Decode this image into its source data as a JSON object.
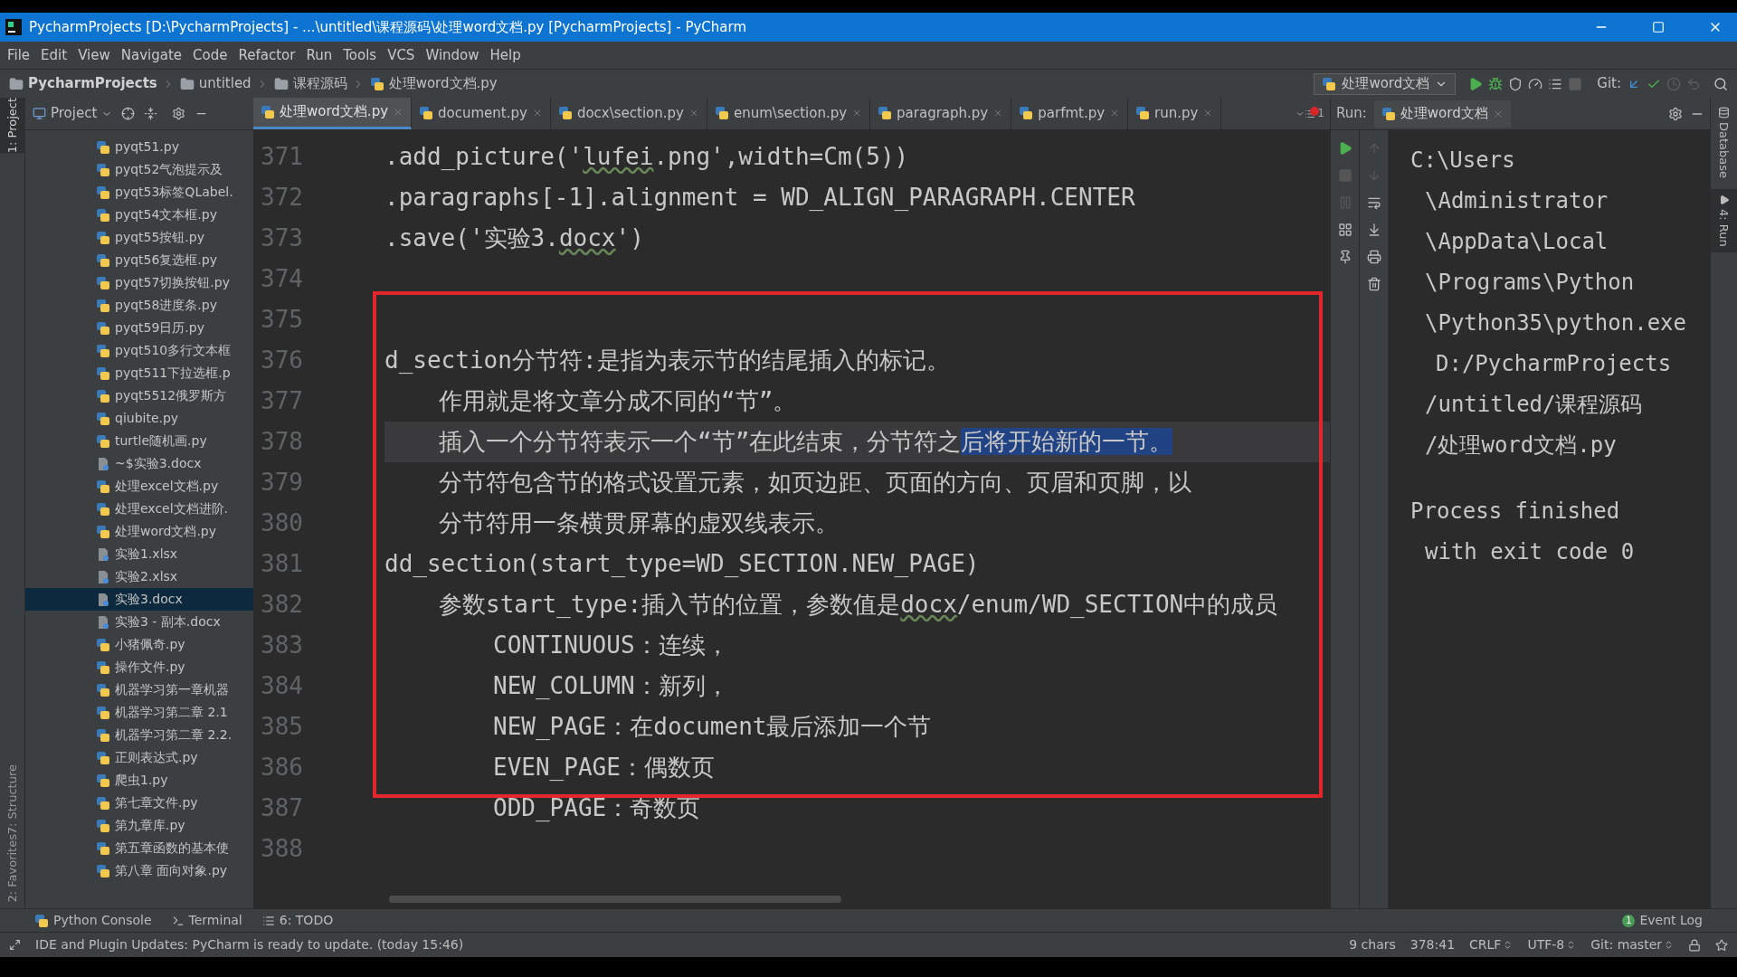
{
  "window": {
    "title": "PycharmProjects [D:\\PycharmProjects] - ...\\untitled\\课程源码\\处理word文档.py [PycharmProjects] - PyCharm"
  },
  "menu": [
    "File",
    "Edit",
    "View",
    "Navigate",
    "Code",
    "Refactor",
    "Run",
    "Tools",
    "VCS",
    "Window",
    "Help"
  ],
  "breadcrumbs": [
    {
      "label": "PycharmProjects",
      "kind": "root"
    },
    {
      "label": "untitled",
      "kind": "folder"
    },
    {
      "label": "课程源码",
      "kind": "folder"
    },
    {
      "label": "处理word文档.py",
      "kind": "py"
    }
  ],
  "run_config": "处理word文档",
  "git_label": "Git:",
  "left_side_tabs": [
    {
      "label": "1: Project",
      "selected": true
    },
    {
      "label": "7: Structure",
      "selected": false
    },
    {
      "label": "2: Favorites",
      "selected": false
    }
  ],
  "project": {
    "title": "Project",
    "items": [
      {
        "label": "pyqt51.py",
        "kind": "py",
        "selected": false
      },
      {
        "label": "pyqt52气泡提示及",
        "kind": "py",
        "selected": false
      },
      {
        "label": "pyqt53标签QLabel.",
        "kind": "py",
        "selected": false
      },
      {
        "label": "pyqt54文本框.py",
        "kind": "py",
        "selected": false
      },
      {
        "label": "pyqt55按钮.py",
        "kind": "py",
        "selected": false
      },
      {
        "label": "pyqt56复选框.py",
        "kind": "py",
        "selected": false
      },
      {
        "label": "pyqt57切换按钮.py",
        "kind": "py",
        "selected": false
      },
      {
        "label": "pyqt58进度条.py",
        "kind": "py",
        "selected": false
      },
      {
        "label": "pyqt59日历.py",
        "kind": "py",
        "selected": false
      },
      {
        "label": "pyqt510多行文本框",
        "kind": "py",
        "selected": false
      },
      {
        "label": "pyqt511下拉选框.p",
        "kind": "py",
        "selected": false
      },
      {
        "label": "pyqt5512俄罗斯方",
        "kind": "py",
        "selected": false
      },
      {
        "label": "qiubite.py",
        "kind": "py",
        "selected": false
      },
      {
        "label": "turtle随机画.py",
        "kind": "py",
        "selected": false
      },
      {
        "label": "~$实验3.docx",
        "kind": "file",
        "selected": false
      },
      {
        "label": "处理excel文档.py",
        "kind": "py",
        "selected": false
      },
      {
        "label": "处理excel文档进阶.",
        "kind": "py",
        "selected": false
      },
      {
        "label": "处理word文档.py",
        "kind": "py",
        "selected": false
      },
      {
        "label": "实验1.xlsx",
        "kind": "file",
        "selected": false
      },
      {
        "label": "实验2.xlsx",
        "kind": "file",
        "selected": false
      },
      {
        "label": "实验3.docx",
        "kind": "file",
        "selected": true
      },
      {
        "label": "实验3 - 副本.docx",
        "kind": "file",
        "selected": false
      },
      {
        "label": "小猪佩奇.py",
        "kind": "py",
        "selected": false
      },
      {
        "label": "操作文件.py",
        "kind": "py",
        "selected": false
      },
      {
        "label": "机器学习第一章机器",
        "kind": "py",
        "selected": false
      },
      {
        "label": "机器学习第二章 2.1",
        "kind": "py",
        "selected": false
      },
      {
        "label": "机器学习第二章 2.2.",
        "kind": "py",
        "selected": false
      },
      {
        "label": "正则表达式.py",
        "kind": "py",
        "selected": false
      },
      {
        "label": "爬虫1.py",
        "kind": "py",
        "selected": false
      },
      {
        "label": "第七章文件.py",
        "kind": "py",
        "selected": false
      },
      {
        "label": "第九章库.py",
        "kind": "py",
        "selected": false
      },
      {
        "label": "第五章函数的基本使",
        "kind": "py",
        "selected": false
      },
      {
        "label": "第八章 面向对象.py",
        "kind": "py",
        "selected": false
      }
    ]
  },
  "editor_tabs": [
    {
      "label": "处理word文档.py",
      "selected": true
    },
    {
      "label": "document.py",
      "selected": false
    },
    {
      "label": "docx\\section.py",
      "selected": false
    },
    {
      "label": "enum\\section.py",
      "selected": false
    },
    {
      "label": "paragraph.py",
      "selected": false
    },
    {
      "label": "parfmt.py",
      "selected": false
    },
    {
      "label": "run.py",
      "selected": false
    }
  ],
  "tab_overflow": "1",
  "lines": [
    {
      "number": "371",
      "kind": "code",
      "current": false,
      "segments": [
        {
          "text": ".add_picture('",
          "selected": false,
          "misspelled": false
        },
        {
          "text": "lufei",
          "selected": false,
          "misspelled": true
        },
        {
          "text": ".png',width=Cm(5))",
          "selected": false,
          "misspelled": false
        }
      ]
    },
    {
      "number": "372",
      "kind": "code",
      "current": false,
      "segments": [
        {
          "text": ".paragraphs[-1].alignment = WD_ALIGN_PARAGRAPH.CENTER",
          "selected": false,
          "misspelled": false
        }
      ]
    },
    {
      "number": "373",
      "kind": "code",
      "current": false,
      "segments": [
        {
          "text": ".save('实验3.",
          "selected": false,
          "misspelled": false
        },
        {
          "text": "docx",
          "selected": false,
          "misspelled": true
        },
        {
          "text": "')",
          "selected": false,
          "misspelled": false
        }
      ]
    },
    {
      "number": "374",
      "kind": "code",
      "current": false
    },
    {
      "number": "375",
      "kind": "code",
      "current": false
    },
    {
      "number": "376",
      "kind": "code",
      "current": false,
      "segments": [
        {
          "text": "d_section分节符:是指为表示节的结尾插入的标记。",
          "selected": false,
          "misspelled": false
        }
      ]
    },
    {
      "number": "377",
      "kind": "doc",
      "current": false,
      "segments": [
        {
          "text": "作用就是将文章分成不同的“节”。",
          "selected": false,
          "misspelled": false
        }
      ]
    },
    {
      "number": "378",
      "kind": "doc",
      "current": true,
      "segments": [
        {
          "text": "插入一个分节符表示一个“节”在此结束，分节符之",
          "selected": false,
          "misspelled": false
        },
        {
          "text": "后将开始新的一节。",
          "selected": true,
          "misspelled": false
        }
      ]
    },
    {
      "number": "379",
      "kind": "doc",
      "current": false,
      "segments": [
        {
          "text": "分节符包含节的格式设置元素，如页边距、页面的方向、页眉和页脚，以",
          "selected": false,
          "misspelled": false
        }
      ]
    },
    {
      "number": "380",
      "kind": "doc",
      "current": false,
      "segments": [
        {
          "text": "分节符用一条横贯屏幕的虚双线表示。",
          "selected": false,
          "misspelled": false
        }
      ]
    },
    {
      "number": "381",
      "kind": "code",
      "current": false,
      "segments": [
        {
          "text": "dd_section(start_type=WD_SECTION.NEW_PAGE)",
          "selected": false,
          "misspelled": false
        }
      ]
    },
    {
      "number": "382",
      "kind": "doc",
      "current": false,
      "segments": [
        {
          "text": "参数start_type:插入节的位置，参数值是",
          "selected": false,
          "misspelled": false
        },
        {
          "text": "docx",
          "selected": false,
          "misspelled": true
        },
        {
          "text": "/enum/WD_SECTION中的成员",
          "selected": false,
          "misspelled": false
        }
      ]
    },
    {
      "number": "383",
      "kind": "item",
      "current": false,
      "segments": [
        {
          "text": "CONTINUOUS：连续，",
          "selected": false,
          "misspelled": false
        }
      ]
    },
    {
      "number": "384",
      "kind": "item",
      "current": false,
      "segments": [
        {
          "text": "NEW_COLUMN：新列，",
          "selected": false,
          "misspelled": false
        }
      ]
    },
    {
      "number": "385",
      "kind": "item",
      "current": false,
      "segments": [
        {
          "text": "NEW_PAGE：在document最后添加一个节",
          "selected": false,
          "misspelled": false
        }
      ]
    },
    {
      "number": "386",
      "kind": "item",
      "current": false,
      "segments": [
        {
          "text": "EVEN_PAGE：偶数页",
          "selected": false,
          "misspelled": false
        }
      ]
    },
    {
      "number": "387",
      "kind": "item",
      "current": false,
      "segments": [
        {
          "text": "ODD_PAGE：奇数页",
          "selected": false,
          "misspelled": false
        }
      ]
    },
    {
      "number": "388",
      "kind": "code",
      "current": false
    }
  ],
  "run": {
    "label": "Run:",
    "tab": "处理word文档",
    "output": [
      {
        "text": "C:\\Users",
        "kind": "start"
      },
      {
        "text": "\\Administrator",
        "kind": "wrap"
      },
      {
        "text": "\\AppData\\Local",
        "kind": "wrap"
      },
      {
        "text": "\\Programs\\Python",
        "kind": "wrap"
      },
      {
        "text": "\\Python35\\python.exe",
        "kind": "wrap"
      },
      {
        "text": "D:/PycharmProjects",
        "kind": "arg"
      },
      {
        "text": "/untitled/课程源码",
        "kind": "wrap"
      },
      {
        "text": "/处理word文档.py",
        "kind": "wrap"
      },
      {
        "text": "Process finished",
        "kind": "para"
      },
      {
        "text": "with exit code 0",
        "kind": "wrap"
      }
    ]
  },
  "right_side_tabs": [
    {
      "label": "Database",
      "selected": false
    },
    {
      "label": "4: Run",
      "selected": true
    }
  ],
  "bottom_tabs": [
    {
      "label": "Python Console",
      "kind": "console"
    },
    {
      "label": "Terminal",
      "kind": "terminal"
    },
    {
      "label": "6: TODO",
      "kind": "todo"
    }
  ],
  "event_log": {
    "label": "Event Log",
    "count": "1"
  },
  "status_bar": {
    "message": "IDE and Plugin Updates: PyCharm is ready to update. (today 15:46)",
    "items": [
      {
        "text": "9 chars",
        "kind": "plain"
      },
      {
        "text": "378:41",
        "kind": "plain"
      },
      {
        "text": "CRLF",
        "kind": "dropdown"
      },
      {
        "text": "UTF-8",
        "kind": "dropdown"
      },
      {
        "text": "Git: master",
        "kind": "dropdown"
      }
    ]
  }
}
